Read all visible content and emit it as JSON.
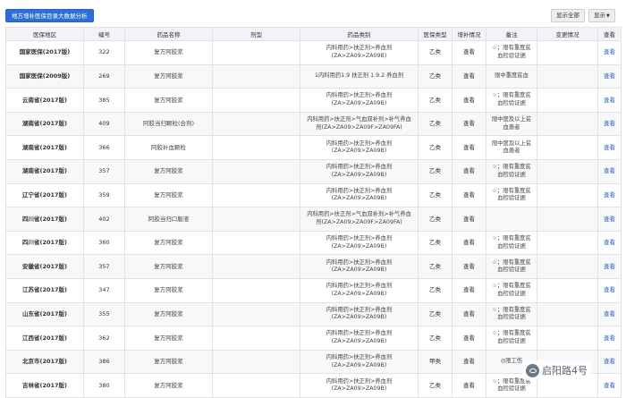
{
  "toolbar": {
    "analysis_button": "地方增补医保目录大数据分析",
    "show_all_button": "显示全部",
    "show_button": "显示"
  },
  "table": {
    "headers": [
      "医保地区",
      "编号",
      "药品名称",
      "剂型",
      "药品类别",
      "医保类型",
      "增补情况",
      "备注",
      "变更情况",
      "查看"
    ],
    "rows": [
      {
        "region": "国家医保(2017版)",
        "no": "322",
        "name": "复方阿胶浆",
        "form": "",
        "cat_lines": [
          "内科用药>扶正剂>养血剂",
          "(ZA>ZA09>ZA09B)"
        ],
        "type": "乙类",
        "supp": "查看",
        "note_lines": [
          "☆；限有重度贫",
          "血检验证据"
        ],
        "change": "",
        "view": "查看"
      },
      {
        "region": "国家医保(2009版)",
        "no": "269",
        "name": "复方阿胶浆",
        "form": "",
        "cat_lines": [
          "1内科用药1.9 扶正剂 1.9.2 养血剂"
        ],
        "type": "乙类",
        "supp": "查看",
        "note_lines": [
          "限中重度贫血"
        ],
        "change": "",
        "view": "查看"
      },
      {
        "region": "云南省(2017版)",
        "no": "385",
        "name": "复方阿胶浆",
        "form": "",
        "cat_lines": [
          "内科用药>扶正剂>养血剂",
          "(ZA>ZA09>ZA09B)"
        ],
        "type": "乙类",
        "supp": "查看",
        "note_lines": [
          "☆；限有重度贫",
          "血检验证据"
        ],
        "change": "",
        "view": "查看"
      },
      {
        "region": "湖南省(2017版)",
        "no": "409",
        "name": "阿胶当归颗粒(合剂)",
        "form": "",
        "cat_lines": [
          "内科用药>扶正剂>气血双补剂>补气养血",
          "剂(ZA>ZA09>ZA09F>ZA09FA)"
        ],
        "type": "乙类",
        "supp": "查看",
        "note_lines": [
          "限中度及以上贫",
          "血患者"
        ],
        "change": "",
        "view": "查看"
      },
      {
        "region": "湖南省(2017版)",
        "no": "366",
        "name": "阿胶补血颗粒",
        "form": "",
        "cat_lines": [
          "内科用药>扶正剂>养血剂",
          "(ZA>ZA09>ZA09B)"
        ],
        "type": "乙类",
        "supp": "查看",
        "note_lines": [
          "限中度及以上贫",
          "血患者"
        ],
        "change": "",
        "view": "查看"
      },
      {
        "region": "湖南省(2017版)",
        "no": "357",
        "name": "复方阿胶浆",
        "form": "",
        "cat_lines": [
          "内科用药>扶正剂>养血剂",
          "(ZA>ZA09>ZA09B)"
        ],
        "type": "乙类",
        "supp": "查看",
        "note_lines": [
          "☆；限有重度贫",
          "血检验证据"
        ],
        "change": "",
        "view": "查看"
      },
      {
        "region": "辽宁省(2017版)",
        "no": "359",
        "name": "复方阿胶浆",
        "form": "",
        "cat_lines": [
          "内科用药>扶正剂>养血剂",
          "(ZA>ZA09>ZA09B)"
        ],
        "type": "乙类",
        "supp": "查看",
        "note_lines": [
          "☆；限有重度贫",
          "血检验证据"
        ],
        "change": "",
        "view": "查看"
      },
      {
        "region": "四川省(2017版)",
        "no": "402",
        "name": "阿胶当归口服液",
        "form": "",
        "cat_lines": [
          "内科用药>扶正剂>气血双补剂>补气养血",
          "剂(ZA>ZA09>ZA09F>ZA09FA)"
        ],
        "type": "乙类",
        "supp": "查看",
        "note_lines": [],
        "change": "",
        "view": "查看"
      },
      {
        "region": "四川省(2017版)",
        "no": "360",
        "name": "复方阿胶浆",
        "form": "",
        "cat_lines": [
          "内科用药>扶正剂>养血剂",
          "(ZA>ZA09>ZA09B)"
        ],
        "type": "乙类",
        "supp": "查看",
        "note_lines": [
          "☆；限有重度贫",
          "血检验证据"
        ],
        "change": "",
        "view": "查看"
      },
      {
        "region": "安徽省(2017版)",
        "no": "357",
        "name": "复方阿胶浆",
        "form": "",
        "cat_lines": [
          "内科用药>扶正剂>养血剂",
          "(ZA>ZA09>ZA09B)"
        ],
        "type": "乙类",
        "supp": "查看",
        "note_lines": [
          "☆；限有重度贫",
          "血检验证据"
        ],
        "change": "",
        "view": "查看"
      },
      {
        "region": "江苏省(2017版)",
        "no": "347",
        "name": "复方阿胶浆",
        "form": "",
        "cat_lines": [
          "内科用药>扶正剂>养血剂",
          "(ZA>ZA09>ZA09B)"
        ],
        "type": "乙类",
        "supp": "查看",
        "note_lines": [
          "☆；限有重度贫",
          "血检验证据"
        ],
        "change": "",
        "view": "查看"
      },
      {
        "region": "山东省(2017版)",
        "no": "355",
        "name": "复方阿胶浆",
        "form": "",
        "cat_lines": [
          "内科用药>扶正剂>养血剂",
          "(ZA>ZA09>ZA09B)"
        ],
        "type": "乙类",
        "supp": "查看",
        "note_lines": [
          "☆；限有重度贫",
          "血检验证据"
        ],
        "change": "",
        "view": "查看"
      },
      {
        "region": "江西省(2017版)",
        "no": "362",
        "name": "复方阿胶浆",
        "form": "",
        "cat_lines": [
          "内科用药>扶正剂>养血剂",
          "(ZA>ZA09>ZA09B)"
        ],
        "type": "乙类",
        "supp": "查看",
        "note_lines": [
          "☆；限有重度贫",
          "血检验证据"
        ],
        "change": "",
        "view": "查看"
      },
      {
        "region": "北京市(2017版)",
        "no": "386",
        "name": "复方阿胶浆",
        "form": "",
        "cat_lines": [
          "内科用药>扶正剂>养血剂",
          "(ZA>ZA09>ZA09B)"
        ],
        "type": "甲类",
        "supp": "查看",
        "note_lines": [
          "◎限工伤"
        ],
        "change": "",
        "view": "查看"
      },
      {
        "region": "吉林省(2017版)",
        "no": "380",
        "name": "复方阿胶浆",
        "form": "",
        "cat_lines": [
          "内科用药>扶正剂>养血剂",
          "(ZA>ZA09>ZA09B)"
        ],
        "type": "乙类",
        "supp": "查看",
        "note_lines": [
          "☆；限有重度贫",
          "血检验证据"
        ],
        "change": "",
        "view": "查看"
      }
    ]
  },
  "watermark": {
    "text": "启阳路4号"
  }
}
